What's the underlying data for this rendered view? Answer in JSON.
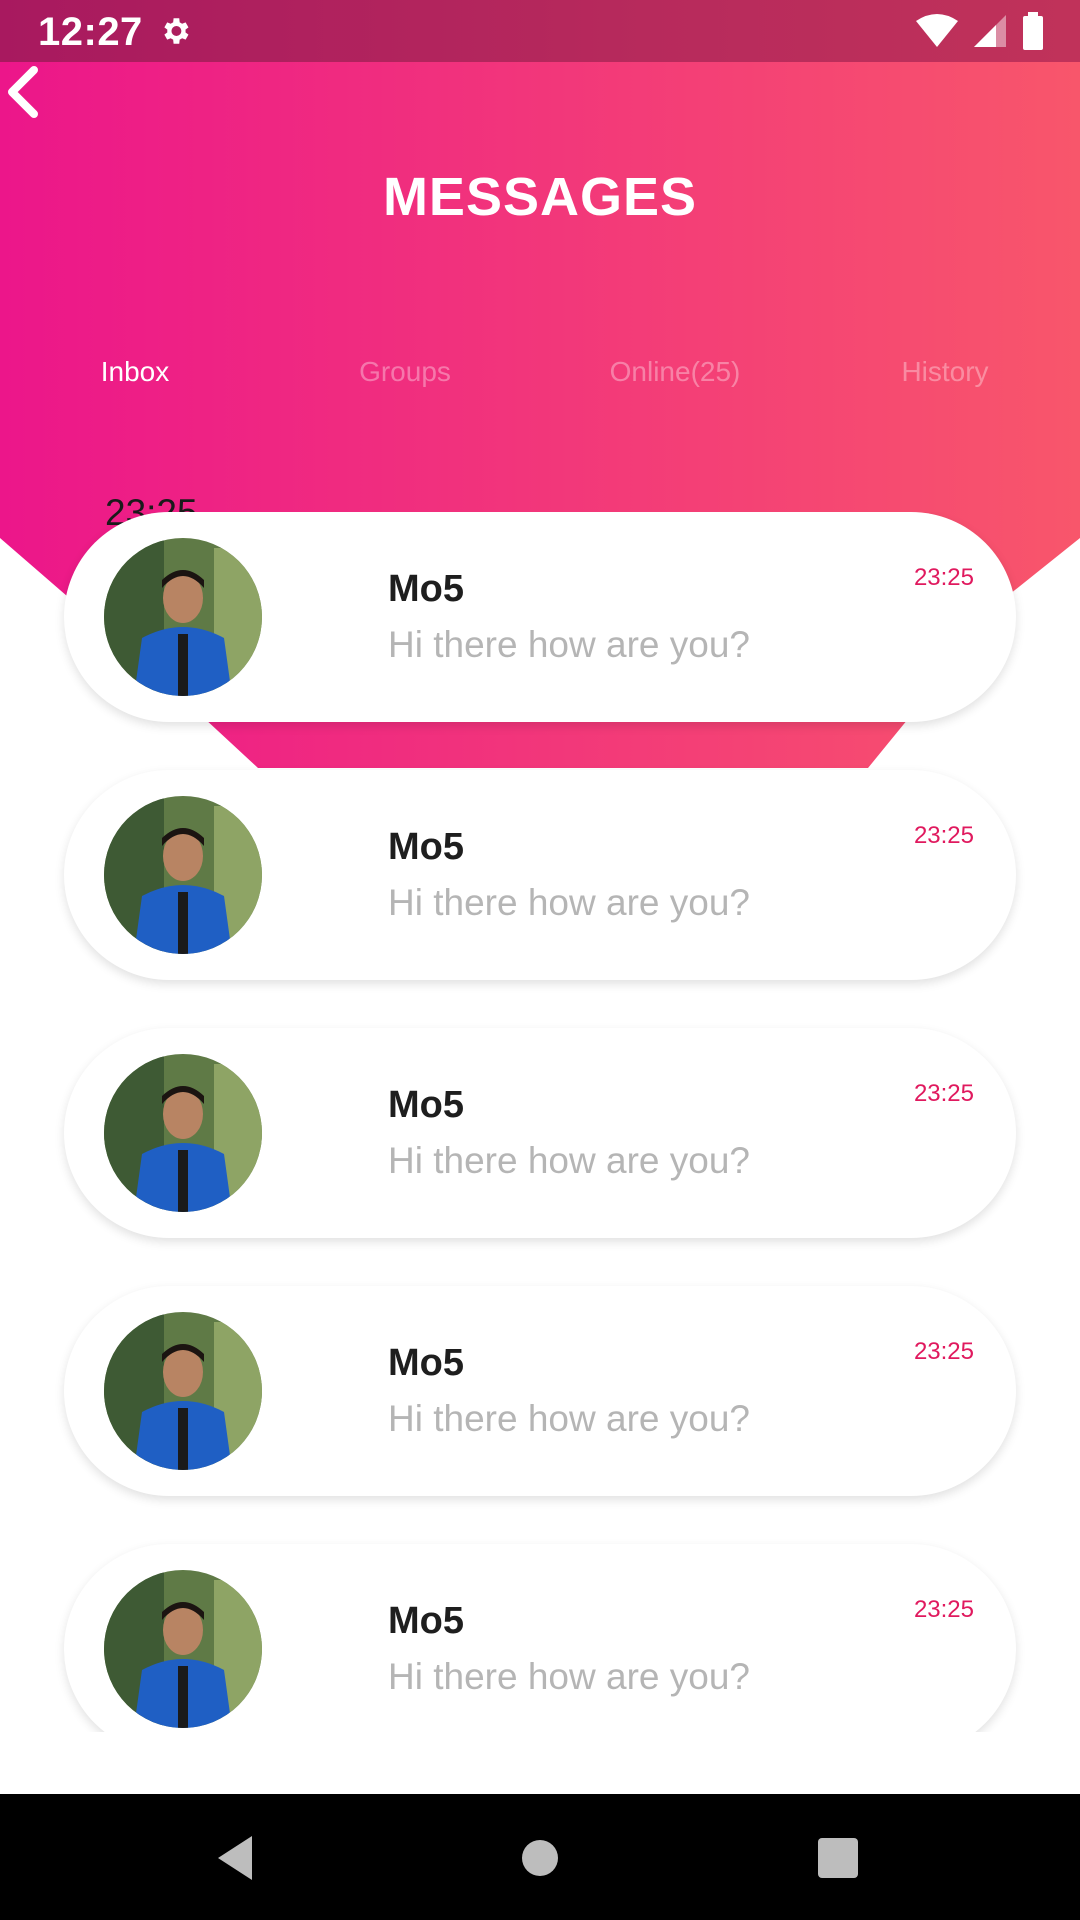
{
  "status_bar": {
    "time": "12:27",
    "icons": [
      "gear-icon",
      "wifi-icon",
      "signal-icon",
      "battery-icon"
    ]
  },
  "header": {
    "title": "MESSAGES",
    "back_icon": "chevron-left-icon",
    "gradient": [
      "#ec168a",
      "#f8566b"
    ]
  },
  "tabs": [
    {
      "label": "Inbox",
      "active": true
    },
    {
      "label": "Groups",
      "active": false
    },
    {
      "label": "Online(25)",
      "active": false
    },
    {
      "label": "History",
      "active": false
    }
  ],
  "section_time": "23:25",
  "messages": [
    {
      "name": "Mo5",
      "preview": "Hi there how are you?",
      "time": "23:25"
    },
    {
      "name": "Mo5",
      "preview": "Hi there how are you?",
      "time": "23:25"
    },
    {
      "name": "Mo5",
      "preview": "Hi there how are you?",
      "time": "23:25"
    },
    {
      "name": "Mo5",
      "preview": "Hi there how are you?",
      "time": "23:25"
    },
    {
      "name": "Mo5",
      "preview": "Hi there how are you?",
      "time": "23:25"
    }
  ],
  "colors": {
    "accent": "#e0195e",
    "title": "#ffffff",
    "name": "#1e1e1e",
    "preview": "#b5b5b5"
  },
  "nav_bar": {
    "icons": [
      "back-triangle-icon",
      "home-circle-icon",
      "recents-square-icon"
    ]
  }
}
